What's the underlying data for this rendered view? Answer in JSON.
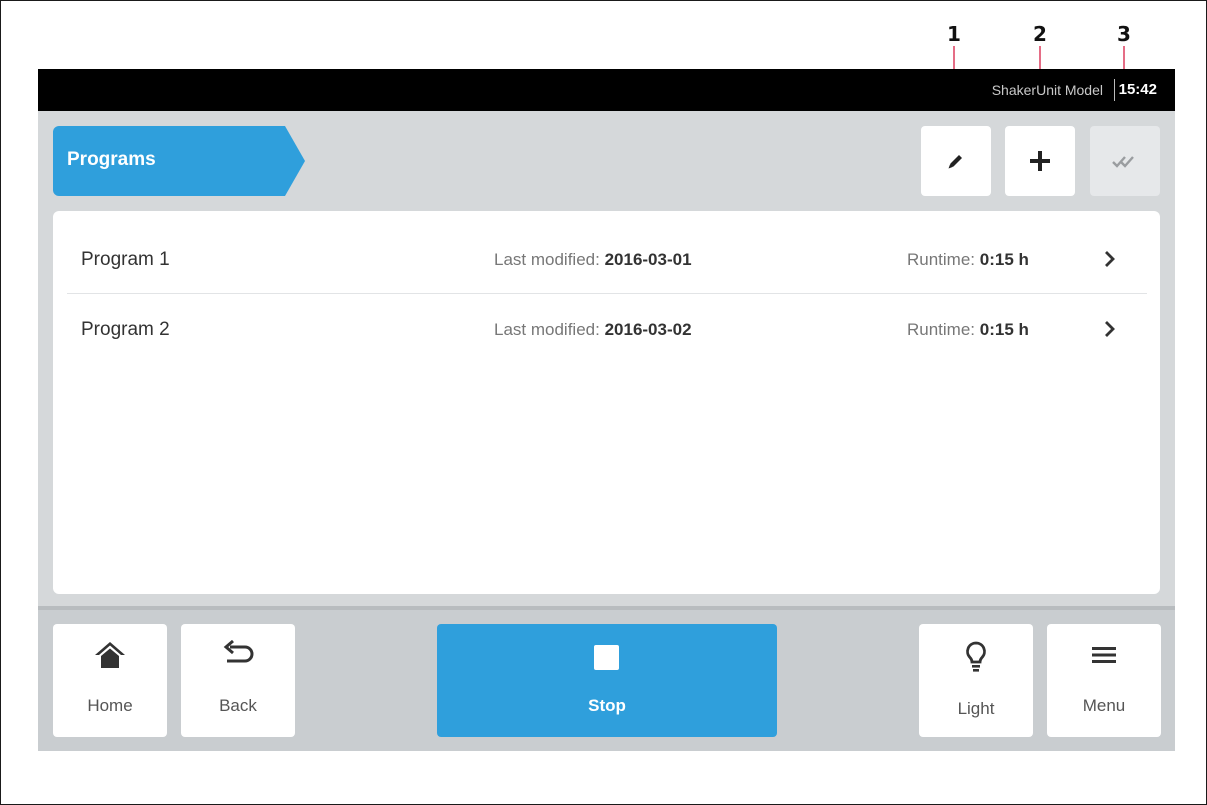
{
  "callouts": [
    "1",
    "2",
    "3"
  ],
  "statusbar": {
    "model": "ShakerUnit Model",
    "time": "15:42"
  },
  "header": {
    "breadcrumb": "Programs"
  },
  "toolbar": {
    "edit_icon": "pencil-icon",
    "add_icon": "plus-icon",
    "select_icon": "double-check-icon"
  },
  "programs": [
    {
      "name": "Program 1",
      "modified_label": "Last modified:",
      "modified": "2016-03-01",
      "runtime_label": "Runtime:",
      "runtime": "0:15 h"
    },
    {
      "name": "Program 2",
      "modified_label": "Last modified:",
      "modified": "2016-03-02",
      "runtime_label": "Runtime:",
      "runtime": "0:15 h"
    }
  ],
  "nav": {
    "home": "Home",
    "back": "Back",
    "stop": "Stop",
    "light": "Light",
    "menu": "Menu"
  },
  "colors": {
    "accent": "#2f9fdc",
    "callout": "#e56d86",
    "background": "#d5d8da"
  }
}
